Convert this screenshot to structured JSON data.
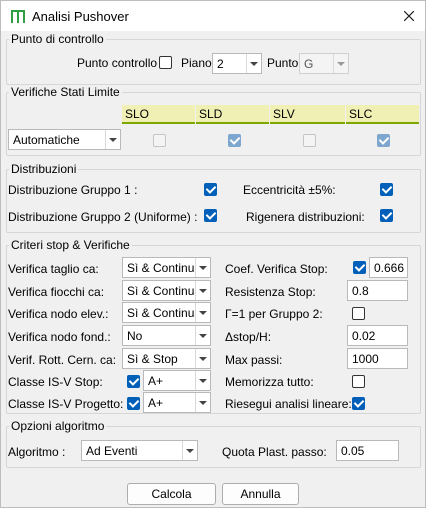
{
  "window": {
    "title": "Analisi Pushover",
    "app_icon": "building-icon",
    "close_icon": "close-icon"
  },
  "punto_di_controllo": {
    "group_title": "Punto di controllo",
    "checkbox_label": "Punto controllo",
    "checkbox_checked": false,
    "piano_label": "Piano",
    "piano_value": "2",
    "punto_label": "Punto",
    "punto_value": "G"
  },
  "verifiche_stati_limite": {
    "group_title": "Verifiche Stati Limite",
    "columns": [
      "SLO",
      "SLD",
      "SLV",
      "SLC"
    ],
    "checked": [
      false,
      true,
      false,
      true
    ],
    "mode_value": "Automatiche"
  },
  "distribuzioni": {
    "group_title": "Distribuzioni",
    "gruppo1_label": "Distribuzione Gruppo 1 :",
    "gruppo1_checked": true,
    "gruppo2_label": "Distribuzione Gruppo 2 (Uniforme) :",
    "gruppo2_checked": true,
    "eccentricita_label": "Eccentricità ±5%:",
    "eccentricita_checked": true,
    "rigenera_label": "Rigenera distribuzioni:",
    "rigenera_checked": true
  },
  "criteri": {
    "group_title": "Criteri stop & Verifiche",
    "left_rows": [
      {
        "label": "Verifica taglio ca:",
        "value": "Sì & Continua"
      },
      {
        "label": "Verifica fiocchi ca:",
        "value": "Sì & Continua"
      },
      {
        "label": "Verifica nodo elev.:",
        "value": "Sì & Continua"
      },
      {
        "label": "Verifica nodo fond.:",
        "value": "No"
      },
      {
        "label": "Verif. Rott. Cern. ca:",
        "value": "Sì & Stop"
      }
    ],
    "classe_stop_label": "Classe IS-V Stop:",
    "classe_stop_checked": true,
    "classe_stop_value": "A+",
    "classe_progetto_label": "Classe IS-V Progetto:",
    "classe_progetto_checked": true,
    "classe_progetto_value": "A+",
    "coef_label": "Coef. Verifica Stop:",
    "coef_checked": true,
    "coef_value": "0.666",
    "resistenza_label": "Resistenza Stop:",
    "resistenza_value": "0.8",
    "gamma_label": "Γ=1 per Gruppo 2:",
    "gamma_checked": false,
    "dstop_label": "Δstop/H:",
    "dstop_value": "0.02",
    "max_passi_label": "Max passi:",
    "max_passi_value": "1000",
    "memorizza_label": "Memorizza tutto:",
    "memorizza_checked": false,
    "riesegui_label": "Riesegui analisi lineare:",
    "riesegui_checked": true
  },
  "opzioni": {
    "group_title": "Opzioni algoritmo",
    "algoritmo_label": "Algoritmo :",
    "algoritmo_value": "Ad Eventi",
    "quota_label": "Quota Plast. passo:",
    "quota_value": "0.05"
  },
  "buttons": {
    "ok": "Calcola",
    "cancel": "Annulla"
  }
}
